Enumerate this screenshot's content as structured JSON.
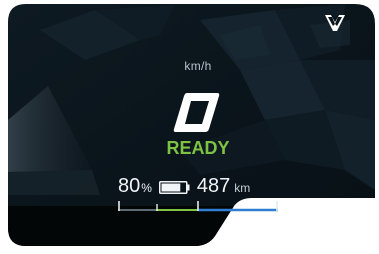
{
  "brand": {
    "logo_icon": "cupra-logo-icon"
  },
  "speed": {
    "value": "0",
    "unit": "km/h"
  },
  "drive_state": {
    "label": "READY"
  },
  "battery": {
    "soc_value": "80",
    "soc_unit": "%",
    "icon": "battery-icon",
    "charge_level": 0.8
  },
  "range": {
    "value": "487",
    "unit": "km"
  },
  "colors": {
    "background": "#0b141b",
    "ready_green": "#7dc243",
    "range_blue": "#2f7ed1",
    "text_white": "#f2f5f7",
    "text_muted": "#b8c3cc"
  }
}
